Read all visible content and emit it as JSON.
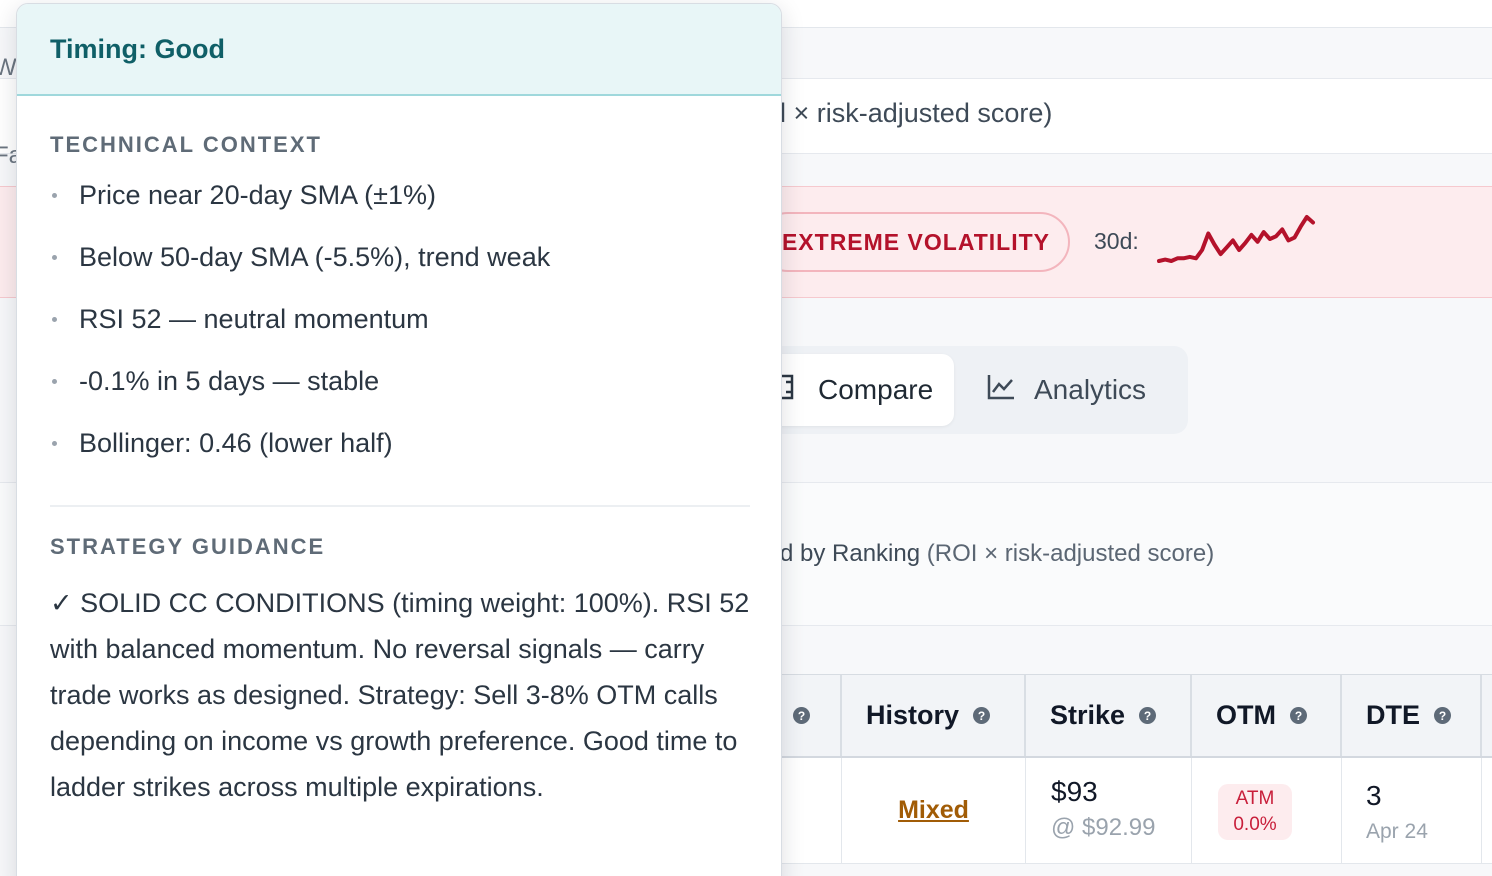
{
  "popover": {
    "title": "Timing: Good",
    "technical_context": {
      "heading": "TECHNICAL CONTEXT",
      "items": [
        "Price near 20-day SMA (±1%)",
        "Below 50-day SMA (-5.5%), trend weak",
        "RSI 52 — neutral momentum",
        "-0.1% in 5 days — stable",
        "Bollinger: 0.46 (lower half)"
      ]
    },
    "strategy_guidance": {
      "heading": "STRATEGY GUIDANCE",
      "text": "✓ SOLID CC CONDITIONS (timing weight: 100%). RSI 52 with balanced momentum. No reversal signals — carry trade works as designed. Strategy: Sell 3-8% OTM calls depending on income vs growth preference. Good time to ladder strikes across multiple expirations."
    }
  },
  "background": {
    "edge_letters": [
      "W",
      "Fa"
    ],
    "subtitle": "l × risk-adjusted score)",
    "volatility": {
      "badge": "EXTREME VOLATILITY",
      "spark_label": "30d:",
      "spark_color": "#b4122b",
      "sparkline_values": [
        10,
        11,
        10,
        12,
        12,
        13,
        12,
        18,
        30,
        22,
        15,
        20,
        25,
        18,
        23,
        29,
        24,
        31,
        26,
        28,
        33,
        25,
        27,
        35,
        42,
        38
      ]
    },
    "tabs": [
      {
        "label": "Compare",
        "icon": "compare-icon"
      },
      {
        "label": "Analytics",
        "icon": "line-chart-icon"
      }
    ],
    "ranking": {
      "prefix": "d by Ranking",
      "suffix": "(ROI × risk-adjusted score)"
    },
    "table": {
      "headers": [
        "History",
        "Strike",
        "OTM",
        "DTE"
      ],
      "row": {
        "history": "Mixed",
        "strike": "$93",
        "strike_sub": "@ $92.99",
        "otm": "ATM",
        "otm_pct": "0.0%",
        "dte": "3",
        "dte_date": "Apr 24"
      }
    }
  }
}
